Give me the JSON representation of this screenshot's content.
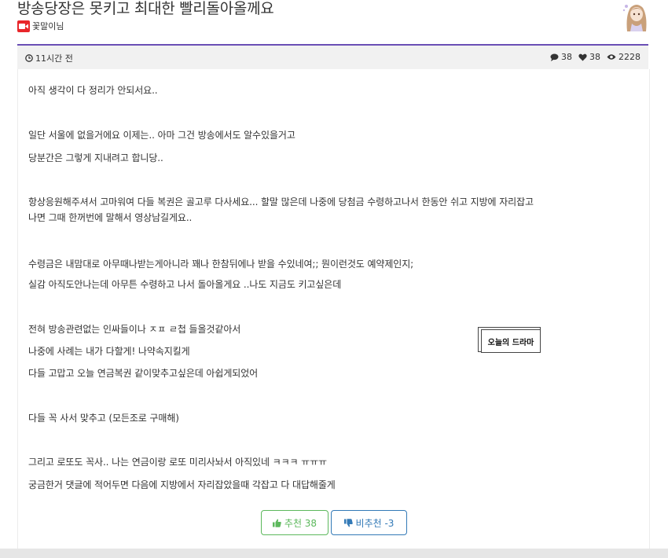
{
  "post": {
    "title": "방송당장은 못키고 최대한 빨리돌아올께요",
    "author": "꽃말이님",
    "time": "11시간 전",
    "comments": "38",
    "likes": "38",
    "views": "2228",
    "lines": [
      "아직 생각이 다 정리가 안되서요..",
      "일단 서울에 없을거에요 이제는.. 아마 그건 방송에서도 알수있을거고",
      "당분간은 그렇게 지내려고 합니당..",
      "항상응원해주셔서 고마워여 다들 복권은 골고루 다사세요... 할말 많은데 나중에 당첨금 수령하고나서 한동안 쉬고 지방에 자리잡고",
      "나면 그때 한꺼번에 말해서 영상남길게요..",
      "수령금은 내맘대로 아무때나받는게아니라 꽤나 한참뒤에나 받을 수있네여;; 뭔이런것도 예약제인지;",
      "실감 아직도안나는데 아무튼 수령하고 나서 돌아올게요 ..나도 지금도 키고싶은데",
      "전혀 방송관련없는 인싸들이나 ㅈㅍ ㄹ첩 들올것같아서",
      "나중에 사례는 내가 다할게! 나약속지킬게",
      "다들 고맙고 오늘 연금복권 같이맞추고싶은데 아쉽게되었어",
      "다들 꼭 사서 맞추고 (모든조로 구매해)",
      "그리고 로또도 꼭사.. 나는 연금이랑 로또 미리사놔서 아직있네 ㅋㅋㅋ ㅠㅠㅠ",
      "궁금한거 댓글에 적어두면 다음에 지방에서 자리잡았을때 각잡고 다 대답해줄게"
    ],
    "watermark": "오늘의 드라마",
    "upvote_label": "추천 38",
    "downvote_label": "비추천 -3"
  },
  "colors": {
    "accent": "#6a4fb5",
    "upvote": "#5cb85c",
    "downvote": "#337ab7",
    "badge": "#e8262a"
  }
}
